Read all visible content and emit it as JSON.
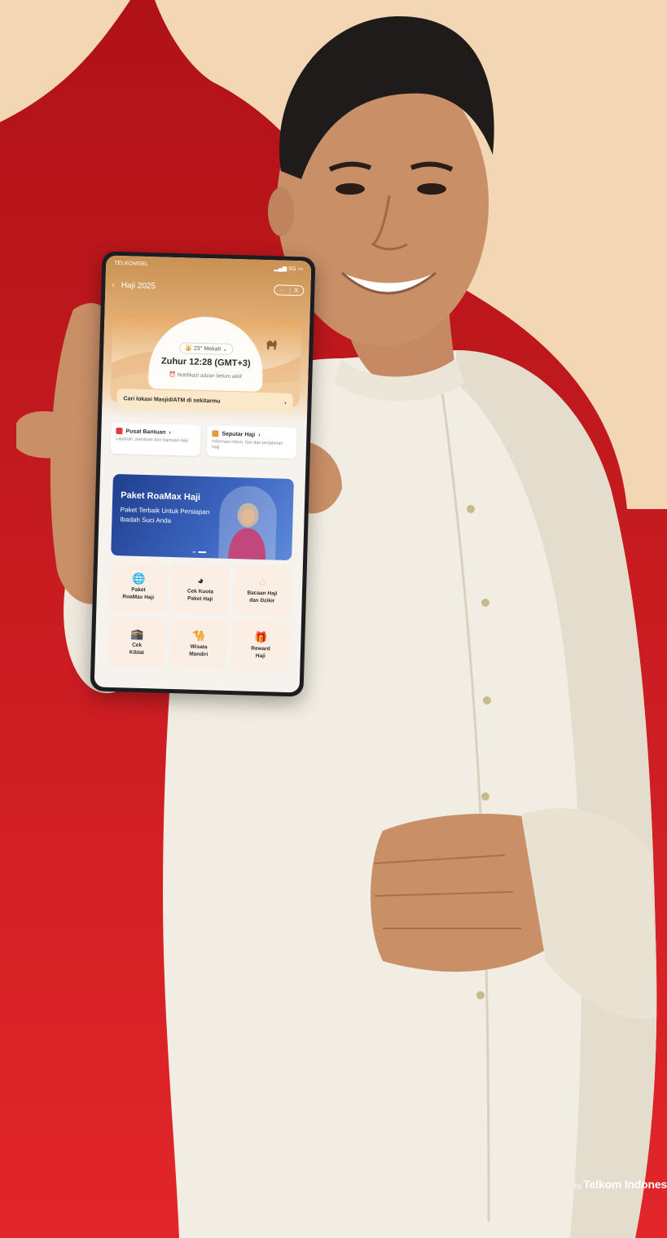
{
  "colors": {
    "bg_red": "#c9161c",
    "cream": "#f3d6b4",
    "shirt": "#f2ede2",
    "banner": "#2a4fa8"
  },
  "phone": {
    "status": {
      "carrier": "TELKOMSEL",
      "signal": "5G"
    },
    "nav": {
      "back_icon": "chevron-left-icon",
      "title": "Haji 2025",
      "more_label": "···",
      "close_label": "X"
    },
    "prayer": {
      "location": "23° Mekah",
      "time": "Zuhur 12:28 (GMT+3)",
      "notice": "Notifikasi adzan belum aktif"
    },
    "finder": {
      "label": "Cari lokasi Masjid/ATM di sekitarmu",
      "arrow": "›"
    },
    "cards": [
      {
        "title": "Pusat Bantuan",
        "arrow": "›",
        "desc": "Layanan, panduan dan bantuan Haji",
        "color": "#e23a3a"
      },
      {
        "title": "Seputar Haji",
        "arrow": "›",
        "desc": "Informasi rukun, fasi dan perjalanan Haji",
        "color": "#e89a3a"
      }
    ],
    "banner": {
      "title": "Paket RoaMax Haji",
      "subtitle": "Paket Terbaik Untuk Persiapan Ibadah Suci Anda"
    },
    "menu": [
      {
        "label": "Paket\nRoaMax Haji",
        "icon": "globe-icon"
      },
      {
        "label": "Cek Kuota\nPaket Haji",
        "icon": "pie-chart-icon"
      },
      {
        "label": "Bacaan Haji\ndan Dzikir",
        "icon": "prayer-beads-icon"
      },
      {
        "label": "Cek\nKiblat",
        "icon": "kaaba-icon"
      },
      {
        "label": "Wisata\nMandiri",
        "icon": "camel-icon"
      },
      {
        "label": "Reward\nHaji",
        "icon": "gift-icon"
      }
    ]
  },
  "brand": {
    "by": "by",
    "name": "Telkom Indones"
  }
}
